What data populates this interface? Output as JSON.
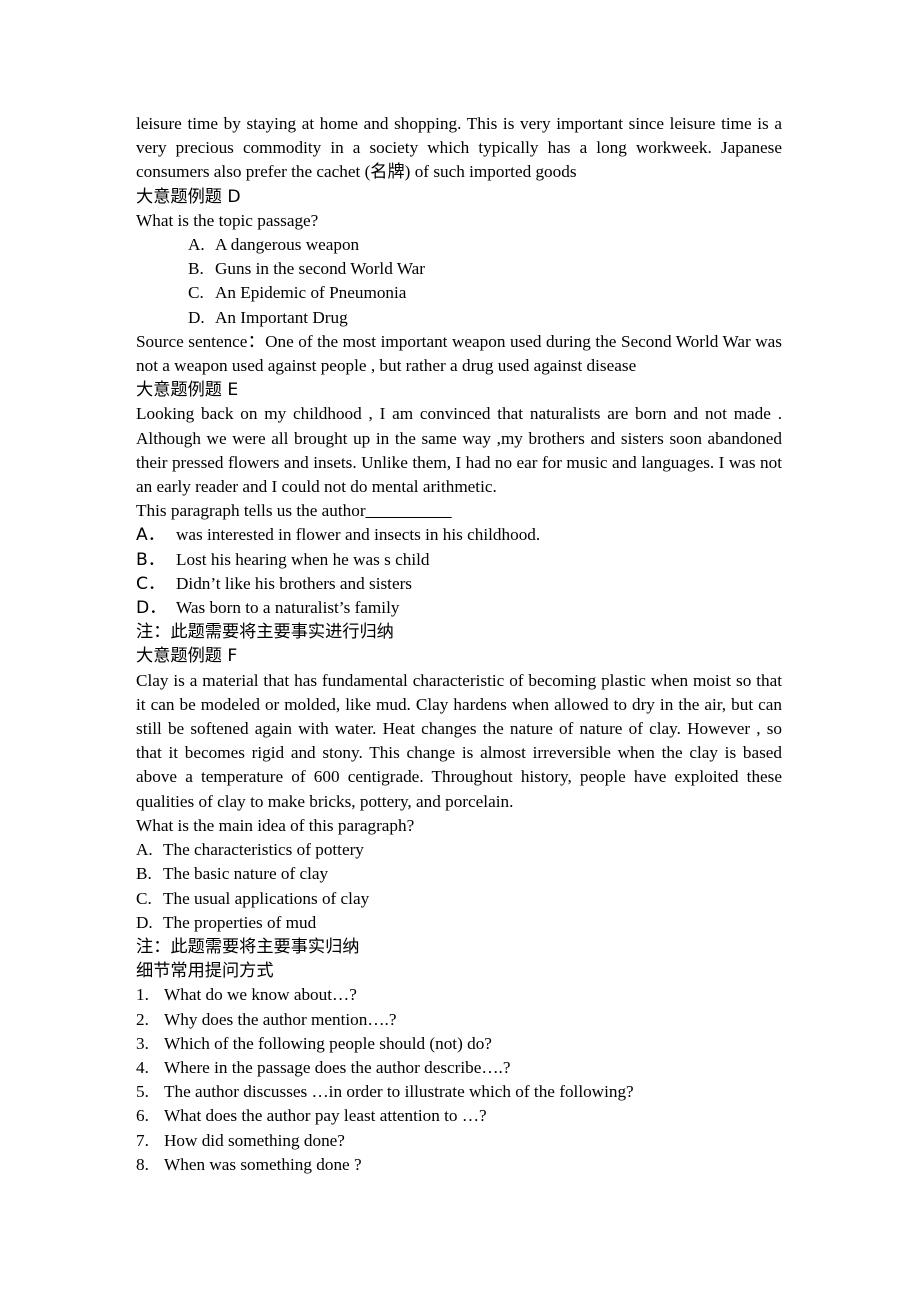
{
  "document": {
    "intro_paragraph": "leisure time by staying at home and shopping. This is very important since leisure time is a very precious commodity in a society which typically has a long workweek. Japanese consumers also prefer the cachet (名牌) of such imported goods",
    "sections": [
      {
        "heading": "大意题例题 D",
        "question": "What is the topic passage?",
        "options": [
          {
            "marker": "A.",
            "text": "A dangerous weapon"
          },
          {
            "marker": "B.",
            "text": "Guns in the second World War"
          },
          {
            "marker": "C.",
            "text": "An Epidemic of Pneumonia"
          },
          {
            "marker": "D.",
            "text": "An Important Drug"
          }
        ],
        "source_sentence": "Source sentence：One of the most important weapon used during the Second World War was not a weapon used against people , but rather a drug used against disease"
      },
      {
        "heading": "大意题例题 E",
        "passage": "Looking back on my childhood , I am convinced that naturalists are born and not made . Although we were all brought up in the same way ,my brothers and sisters soon abandoned their pressed flowers and insets. Unlike them, I had no ear for music and languages. I was not an early reader and I could not do mental arithmetic.",
        "question_lead": "This paragraph tells us the author",
        "question_blank": "__________",
        "options": [
          {
            "marker": "A．",
            "text": "was interested in flower and insects in his childhood."
          },
          {
            "marker": "B．",
            "text": "Lost his hearing when he was s child"
          },
          {
            "marker": "C．",
            "text": "Didn’t like his brothers and sisters"
          },
          {
            "marker": "D．",
            "text": "Was born to a naturalist’s family"
          }
        ],
        "note": "注：此题需要将主要事实进行归纳"
      },
      {
        "heading": "大意题例题 F",
        "passage": "Clay is a material that has fundamental characteristic of becoming plastic when moist so that it can be modeled or molded, like mud. Clay hardens when allowed to dry in the air, but can still be softened again with water. Heat changes the nature of nature of clay. However , so that it becomes rigid and stony. This change is almost irreversible when the clay is based above a temperature of 600 centigrade. Throughout history, people have exploited these qualities of clay to make bricks, pottery, and porcelain.",
        "question": "What is the main idea of this paragraph?",
        "options": [
          {
            "marker": "A.",
            "text": "The characteristics of pottery"
          },
          {
            "marker": "B.",
            "text": "The basic nature of clay"
          },
          {
            "marker": "C.",
            "text": "The usual applications of clay"
          },
          {
            "marker": "D.",
            "text": "The properties of mud"
          }
        ],
        "note": "注：此题需要将主要事实归纳"
      }
    ],
    "detail_section": {
      "heading": "细节常用提问方式",
      "items": [
        {
          "marker": "1.",
          "text": "What do we know about…?"
        },
        {
          "marker": "2.",
          "text": "Why does the author mention….?"
        },
        {
          "marker": "3.",
          "text": "Which of the following people should (not) do?"
        },
        {
          "marker": "4.",
          "text": "Where in the passage does the author describe….?"
        },
        {
          "marker": "5.",
          "text": "The author discusses …in order to illustrate which of the following?"
        },
        {
          "marker": "6.",
          "text": "What does the author pay least attention to …?"
        },
        {
          "marker": "7.",
          "text": "How did something done?"
        },
        {
          "marker": "8.",
          "text": "When was something done ?"
        }
      ]
    }
  }
}
